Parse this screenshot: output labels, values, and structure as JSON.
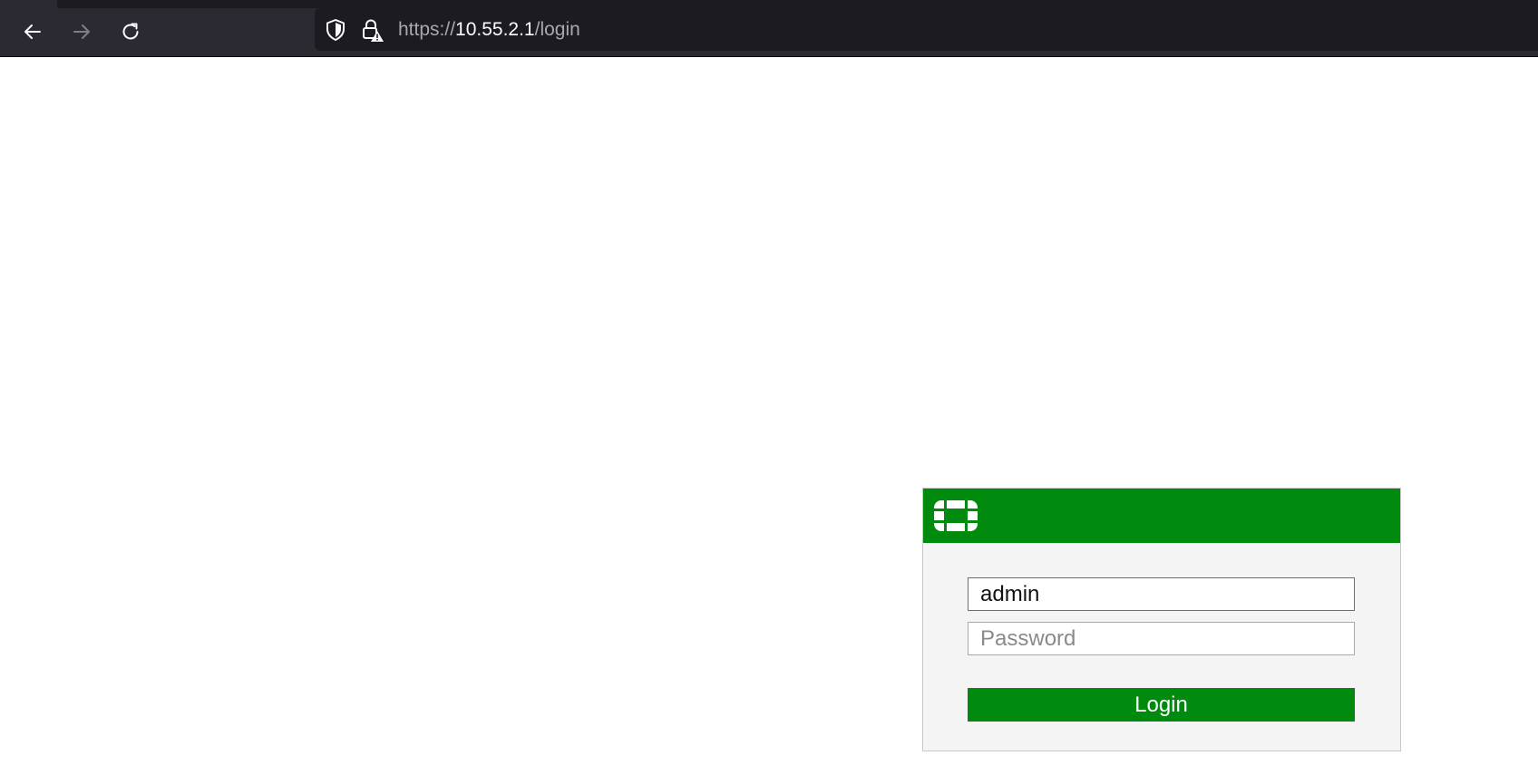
{
  "browser": {
    "url": {
      "scheme": "https://",
      "host": "10.55.2.1",
      "path": "/login"
    },
    "icons": {
      "back": "arrow-left-icon",
      "forward": "arrow-right-icon",
      "reload": "reload-icon",
      "tracking_protection": "shield-icon",
      "connection_insecure": "lock-warning-icon"
    }
  },
  "login": {
    "logo": "fortinet-logo",
    "username_value": "admin",
    "password_placeholder": "Password",
    "login_label": "Login"
  },
  "colors": {
    "brand_green": "#008a0e",
    "toolbar": "#2b2a33",
    "urlbar": "#1c1b22",
    "card_bg": "#f4f4f4"
  }
}
